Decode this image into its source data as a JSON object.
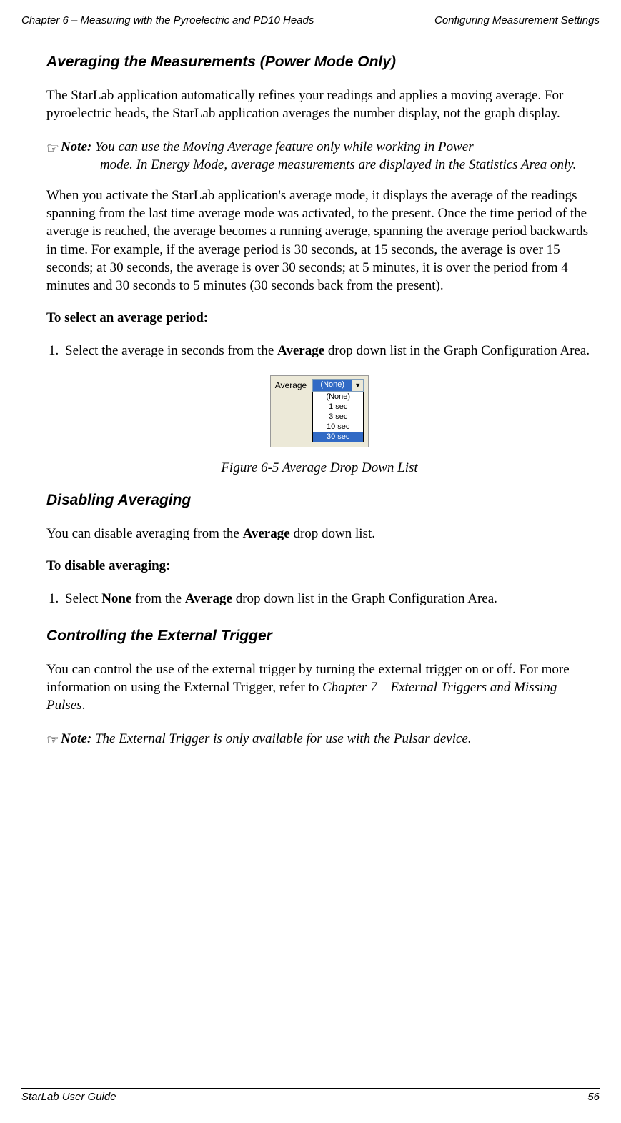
{
  "header": {
    "left": "Chapter 6 – Measuring with the Pyroelectric and PD10 Heads",
    "right": "Configuring Measurement Settings"
  },
  "s1": {
    "title": "Averaging the Measurements (Power Mode Only)",
    "p1": "The StarLab application automatically refines your readings and applies a moving average. For pyroelectric heads, the StarLab application averages the number display, not the graph display.",
    "note1_lead": "Note:",
    "note1_t1": " You can use the Moving Average feature only while working in Power ",
    "note1_t2": "mode. In Energy Mode, average measurements are displayed in the Statistics Area only.",
    "p2": "When you activate the StarLab application's average mode, it displays the average of the readings spanning from the last time average mode was activated, to the present. Once the time period of the average is reached, the average becomes a running average, spanning the average period backwards in time. For example, if the average period is 30 seconds, at 15 seconds, the average is over 15 seconds; at 30 seconds, the average is over 30 seconds; at 5 minutes, it is over the period from 4 minutes and 30 seconds to 5 minutes (30 seconds back from the present).",
    "proc1_head": "To select an average period:",
    "step1_a": "Select the average in seconds from the ",
    "step1_b": "Average",
    "step1_c": " drop down list in the Graph Configuration Area.",
    "fig_caption": "Figure 6-5 Average Drop Down List",
    "dd": {
      "label": "Average",
      "selected": "(None)",
      "options": [
        "(None)",
        "1 sec",
        "3 sec",
        "10 sec",
        "30 sec"
      ]
    }
  },
  "s2": {
    "title": "Disabling Averaging",
    "p1_a": "You can disable averaging from the ",
    "p1_b": "Average",
    "p1_c": " drop down list.",
    "proc_head": "To disable averaging:",
    "step1_a": "Select ",
    "step1_b": "None",
    "step1_c": " from the ",
    "step1_d": "Average",
    "step1_e": " drop down list in the Graph Configuration Area."
  },
  "s3": {
    "title": "Controlling the External Trigger",
    "p1_a": "You can control the use of the external trigger by turning the external trigger on or off. For more information on using the External Trigger, refer to ",
    "p1_b": "Chapter 7 – External Triggers and Missing Pulses",
    "p1_c": ".",
    "note_lead": "Note:",
    "note_t": " The External Trigger is only available for use with the Pulsar device."
  },
  "footer": {
    "left": "StarLab User Guide",
    "right": "56"
  }
}
